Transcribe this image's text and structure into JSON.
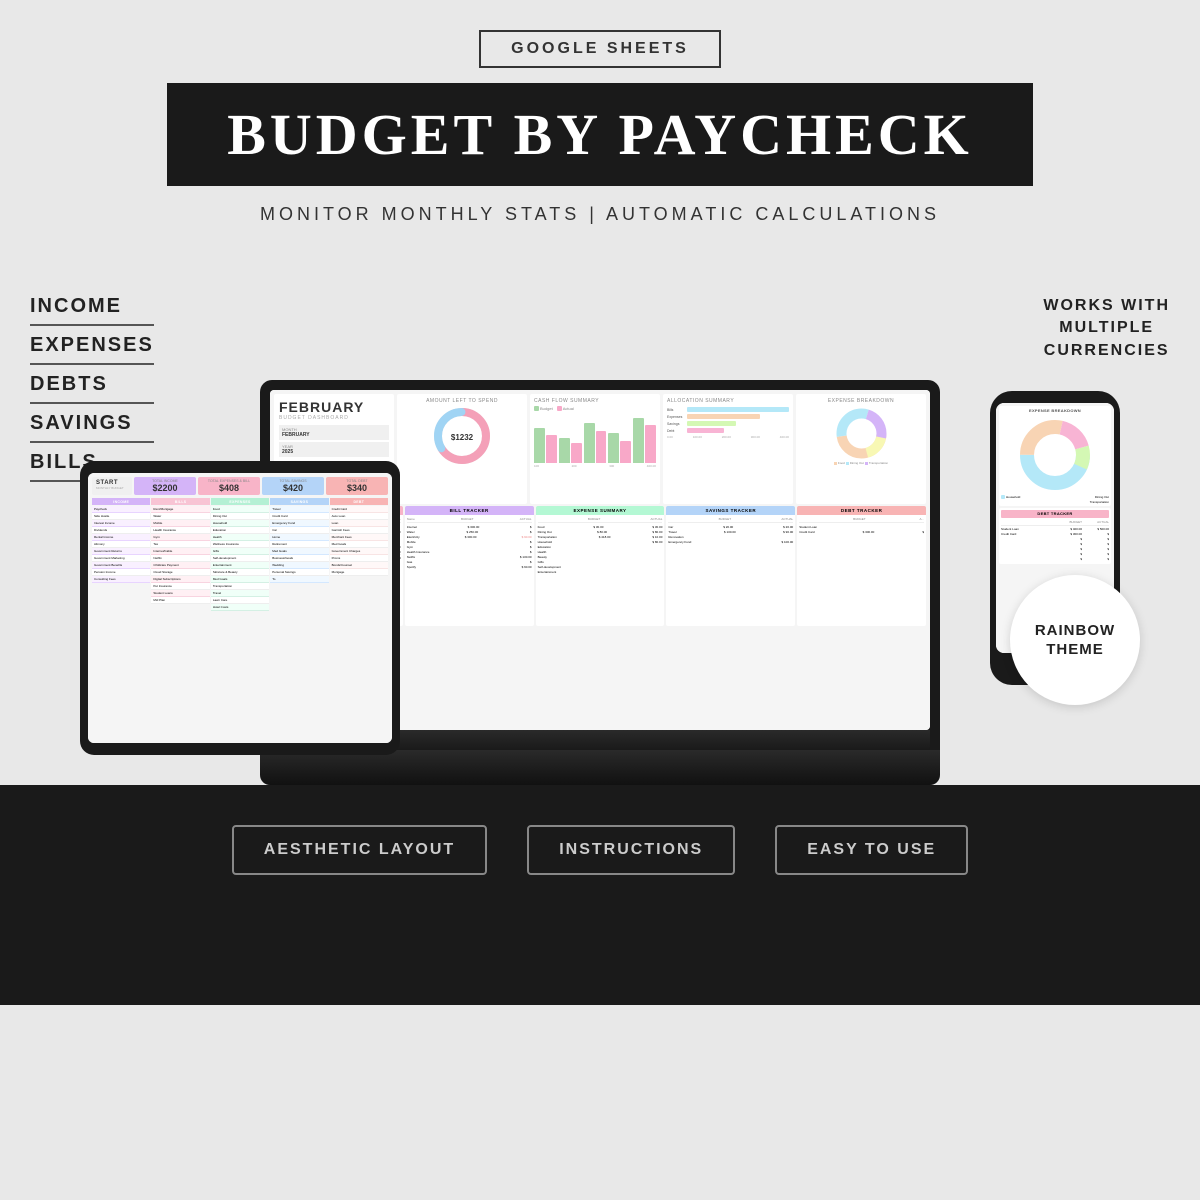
{
  "header": {
    "google_sheets": "GOOGLE SHEETS",
    "main_title": "BUDGET BY PAYCHECK",
    "subtitle": "MONITOR MONTHLY STATS | AUTOMATIC CALCULATIONS"
  },
  "left_labels": {
    "items": [
      "INCOME",
      "EXPENSES",
      "DEBTS",
      "SAVINGS",
      "BILLS"
    ]
  },
  "right_badge": {
    "works_with": "WORKS WITH MULTIPLE CURRENCIES"
  },
  "rainbow_badge": {
    "text": "RAINBOW THEME"
  },
  "bottom_features": {
    "items": [
      "AESTHETIC LAYOUT",
      "INSTRUCTIONS",
      "EASY TO USE"
    ]
  },
  "laptop_screen": {
    "month": "FEBRUARY",
    "sub": "BUDGET DASHBOARD",
    "amount_left": "$1232",
    "panels": {
      "cash_flow": "CASH FLOW SUMMARY",
      "bill_tracker": "BILL TRACKER",
      "expense_summary": "EXPENSE SUMMARY",
      "savings_tracker": "SAVINGS TRACKER",
      "debt_tracker": "DEBT TRACKER"
    }
  },
  "tablet_screen": {
    "label": "START\nMONTHLY BUDGET",
    "total_income": "$2200",
    "total_expenses": "$408",
    "total_savings": "$420",
    "total_debt": "$340",
    "col_headers": [
      "INCOME",
      "BILLS",
      "EXPENSES",
      "SAVINGS",
      "DEBT"
    ],
    "col_colors": [
      "#d4b4f8",
      "#f8b4c8",
      "#b4f8d4",
      "#b4d4f8",
      "#f8b4b4"
    ]
  },
  "phone_screen": {
    "section1": "EXPENSE BREAKDOWN",
    "section2": "DEBT TRACKER",
    "student_loan_budget": "$ 400.00",
    "student_loan_actual": "$ 500.00",
    "credit_card_budget": "$ 300.00"
  }
}
